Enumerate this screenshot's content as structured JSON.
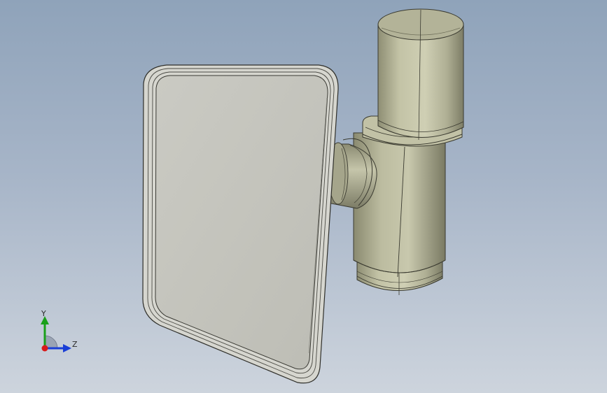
{
  "triad": {
    "y_label": "Y",
    "z_label": "Z"
  },
  "colors": {
    "background_top": "#8fa3ba",
    "background_bottom": "#cdd4dd",
    "mirror_glass": "#c4c4bd",
    "metal": "#b8b89c",
    "axis_y": "#1aa01a",
    "axis_z": "#1a3fd6",
    "axis_x": "#d81a1a"
  }
}
